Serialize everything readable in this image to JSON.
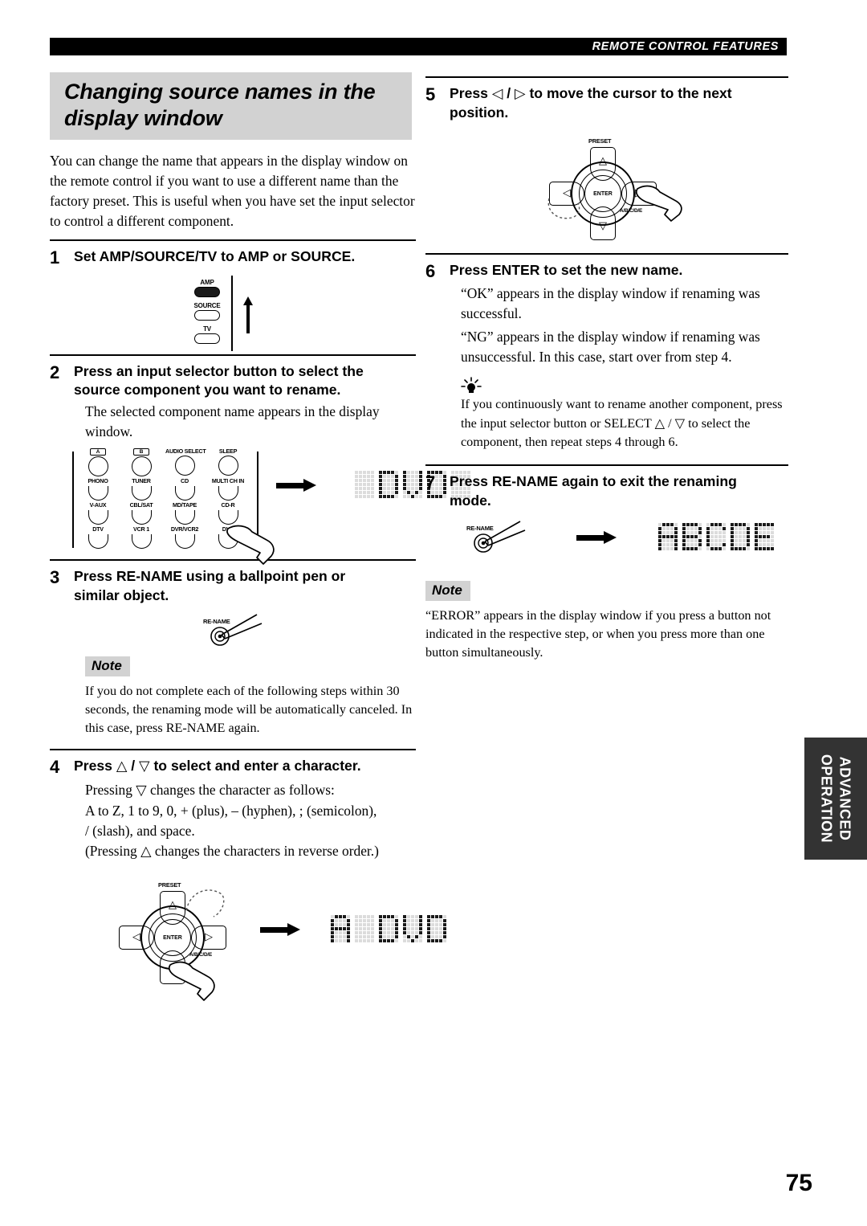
{
  "header": {
    "running_head": "REMOTE CONTROL FEATURES"
  },
  "page": {
    "number": "75"
  },
  "side_tab": {
    "line1": "ADVANCED",
    "line2": "OPERATION"
  },
  "section": {
    "title_line1": "Changing source names in the",
    "title_line2": "display window",
    "intro": "You can change the name that appears in the display window on the remote control if you want to use a different name than the factory preset. This is useful when you have set the input selector to control a different component."
  },
  "steps": {
    "s1": {
      "num": "1",
      "head": "Set AMP/SOURCE/TV to AMP or SOURCE.",
      "switch_labels": [
        "AMP",
        "SOURCE",
        "TV"
      ]
    },
    "s2": {
      "num": "2",
      "head_line1": "Press an input selector button to select the",
      "head_line2": "source component you want to rename.",
      "body": "The selected component name appears in the display window.",
      "buttons_row0": [
        "A",
        "B",
        "AUDIO SELECT",
        "SLEEP"
      ],
      "buttons_row1": [
        "PHONO",
        "TUNER",
        "CD",
        "MULTI CH IN"
      ],
      "buttons_row2": [
        "V-AUX",
        "CBL/SAT",
        "MD/TAPE",
        "CD-R"
      ],
      "buttons_row3": [
        "DTV",
        "VCR 1",
        "DVR/VCR2",
        "DVD"
      ],
      "lcd": "_DVD_"
    },
    "s3": {
      "num": "3",
      "head_line1": "Press RE-NAME using a ballpoint pen or",
      "head_line2": "similar object.",
      "pen_label": "RE-NAME",
      "note_tag": "Note",
      "note_body": "If you do not complete each of the following steps within 30 seconds, the renaming mode will be automatically canceled. In this case, press RE-NAME again."
    },
    "s4": {
      "num": "4",
      "head_pre": "Press ",
      "head_sym1": "△",
      "head_mid": " / ",
      "head_sym2": "▽",
      "head_post": " to select and enter a character.",
      "body_line1_pre": "Pressing ",
      "body_line1_sym": "▽",
      "body_line1_post": " changes the character as follows:",
      "body_line2": "A to Z, 1 to 9, 0, + (plus), – (hyphen), ; (semicolon),",
      "body_line3": "/ (slash), and space.",
      "body_line4_pre": "(Pressing ",
      "body_line4_sym": "△",
      "body_line4_post": " changes the characters in reverse order.)",
      "dpad_preset": "PRESET",
      "dpad_abcde": "A/B/C/D/E",
      "dpad_enter": "ENTER",
      "lcd": "A_DVD"
    },
    "s5": {
      "num": "5",
      "head_pre": "Press ",
      "head_sym1": "◁",
      "head_mid": " / ",
      "head_sym2": "▷",
      "head_post": " to move the cursor to the next",
      "head_line2": "position.",
      "dpad_preset": "PRESET",
      "dpad_abcde": "A/B/C/D/E",
      "dpad_enter": "ENTER"
    },
    "s6": {
      "num": "6",
      "head": "Press ENTER to set the new name.",
      "body_line1": "“OK” appears in the display window if renaming was successful.",
      "body_line2": "“NG” appears in the display window if renaming was unsuccessful. In this case, start over from step 4.",
      "tip_icon": "tip-lightbulb-icon",
      "tip_pre": "If you continuously want to rename another component, press the input selector button or SELECT ",
      "tip_sym1": "△",
      "tip_mid": " / ",
      "tip_sym2": "▽",
      "tip_post": " to select the component, then repeat steps 4 through 6."
    },
    "s7": {
      "num": "7",
      "head_line1": "Press RE-NAME again to exit the renaming",
      "head_line2": "mode.",
      "pen_label": "RE-NAME",
      "lcd": "ABCDE",
      "note_tag": "Note",
      "note_body": "“ERROR” appears in the display window if you press a button not indicated in the respective step, or when you press more than one button simultaneously."
    }
  },
  "colors": {
    "header_band": "#000000",
    "title_bg": "#d2d2d2",
    "note_bg": "#d2d2d2",
    "side_tab_bg": "#333333",
    "lcd_on": "#1a1a1a",
    "lcd_off": "#dcdcdc"
  }
}
